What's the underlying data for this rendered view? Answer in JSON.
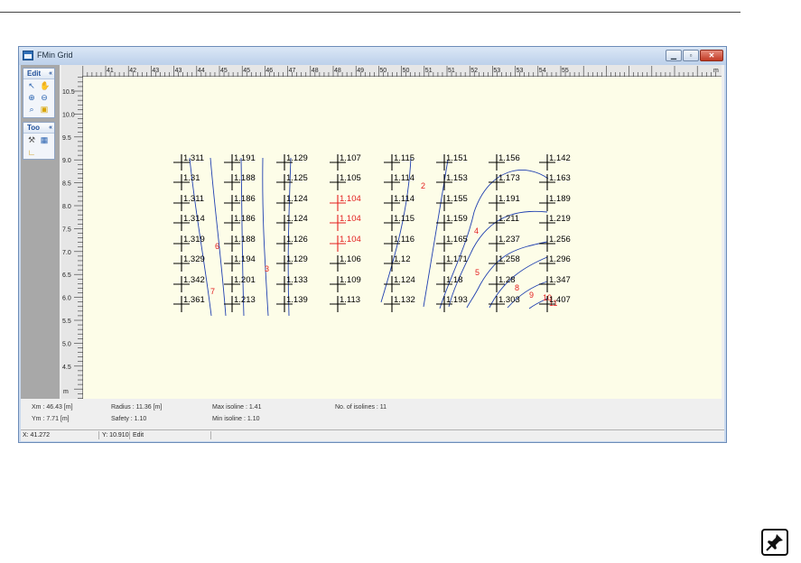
{
  "window": {
    "title": "FMin Grid",
    "minimize_glyph": "▁",
    "maximize_glyph": "▫",
    "close_glyph": "✕"
  },
  "toolbox": {
    "edit_group": {
      "label": "Edit",
      "chevron": "«",
      "icons": [
        "pointer-icon",
        "hand-pan-icon",
        "zoom-in-icon",
        "zoom-out-icon",
        "zoom-reset-icon",
        "zoom-window-icon"
      ]
    },
    "tool_group": {
      "label": "Too",
      "chevron": "«",
      "icons": [
        "pick-tool-icon",
        "grid-tool-icon",
        "ruler-icon"
      ]
    }
  },
  "ruler": {
    "x_ticks": [
      "41",
      "42",
      "43",
      "43",
      "44",
      "45",
      "45",
      "46",
      "47",
      "48",
      "48",
      "49",
      "50",
      "50",
      "51",
      "51",
      "52",
      "53",
      "53",
      "54",
      "55"
    ],
    "x_unit": "m",
    "y_ticks": [
      "10.5",
      "10.0",
      "9.5",
      "9.0",
      "8.5",
      "8.0",
      "7.5",
      "7.0",
      "6.5",
      "6.0",
      "5.5",
      "5.0",
      "4.5"
    ],
    "y_unit": "m"
  },
  "grid": {
    "columns": [
      [
        "1.311",
        "1.31",
        "1.311",
        "1.314",
        "1.319",
        "1.329",
        "1.342",
        "1.361"
      ],
      [
        "1.191",
        "1.188",
        "1.186",
        "1.186",
        "1.188",
        "1.194",
        "1.201",
        "1.213"
      ],
      [
        "1.129",
        "1.125",
        "1.124",
        "1.124",
        "1.126",
        "1.129",
        "1.133",
        "1.139"
      ],
      [
        "1.107",
        "1.105",
        "1.104",
        "1.104",
        "1.104",
        "1.106",
        "1.109",
        "1.113"
      ],
      [
        "1.115",
        "1.114",
        "1.114",
        "1.115",
        "1.116",
        "1.12",
        "1.124",
        "1.132"
      ],
      [
        "1.151",
        "1.153",
        "1.155",
        "1.159",
        "1.165",
        "1.171",
        "1.18",
        "1.193"
      ],
      [
        "1.156",
        "1.173",
        "1.191",
        "1.211",
        "1.237",
        "1.258",
        "1.28",
        "1.303"
      ],
      [
        "1.142",
        "1.163",
        "1.189",
        "1.219",
        "1.256",
        "1.296",
        "1.347",
        "1.407"
      ]
    ],
    "highlight": {
      "column": 3,
      "rows": [
        2,
        3,
        4
      ],
      "color": "#e32020"
    },
    "point_color": "#000000",
    "isoline_color": "#2040b0"
  },
  "contour_labels": [
    "2",
    "3",
    "4",
    "5",
    "6",
    "7",
    "8",
    "9",
    "10",
    "11"
  ],
  "info": {
    "xm": "Xm : 46.43 [m]",
    "ym": "Ym : 7.71 [m]",
    "radius": "Radius : 11.36 [m]",
    "safety": "Safety : 1.10",
    "max_isoline": "Max isoline : 1.41",
    "min_isoline": "Min isoline : 1.10",
    "num_isolines": "No. of isolines : 11"
  },
  "status": {
    "x": "X: 41.272",
    "y": "Y: 10.910",
    "mode": "Edit"
  },
  "colors": {
    "plot_bg": "#fdfde8",
    "accent": "#e32020",
    "isoline": "#2040b0"
  }
}
